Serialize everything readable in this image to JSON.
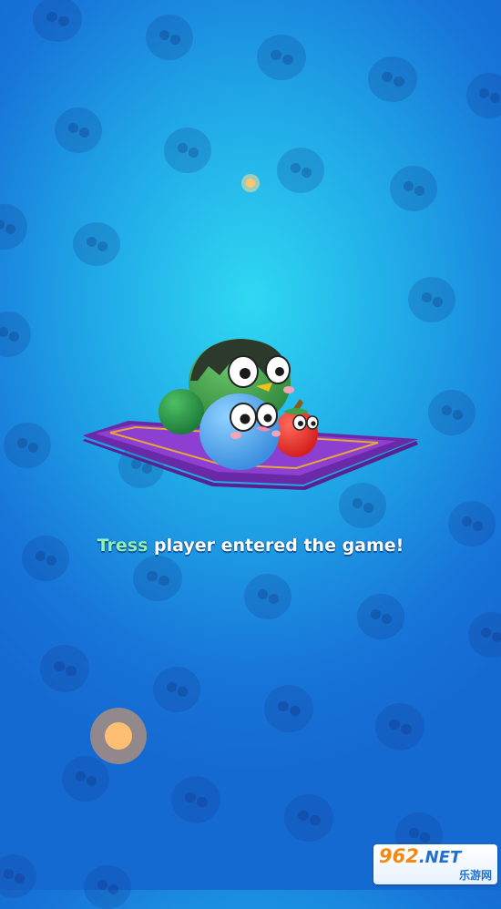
{
  "message": {
    "player_name": "Tress",
    "text": " player entered the game!"
  },
  "watermark": {
    "brand_number": "962",
    "brand_suffix": ".NET",
    "brand_cn": "乐游网"
  },
  "colors": {
    "player_name": "#8ff0b8",
    "background_center": "#2fd8f2",
    "background_edge": "#156ad2",
    "joystick": "#ffbf72"
  },
  "icons": [
    "blob-pattern-icon",
    "orb-icon",
    "joystick-icon",
    "magic-carpet-icon"
  ]
}
